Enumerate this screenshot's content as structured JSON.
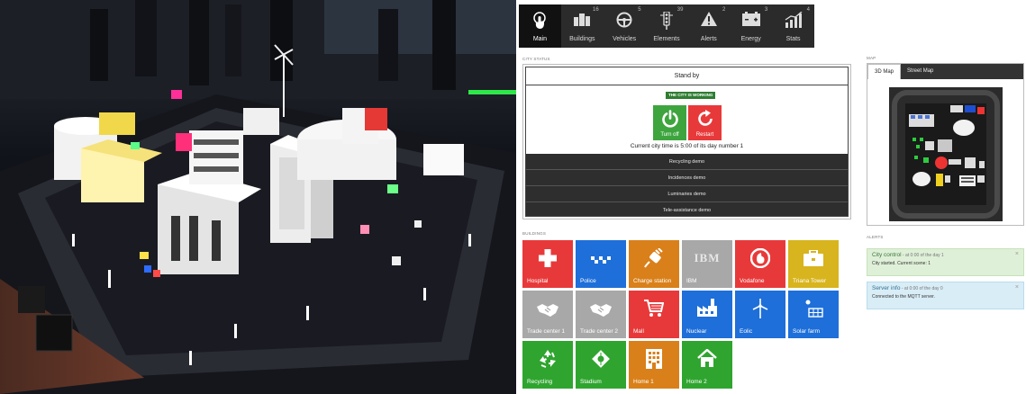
{
  "nav": {
    "items": [
      {
        "label": "Main",
        "count": "",
        "icon": "touch-icon",
        "active": true
      },
      {
        "label": "Buildings",
        "count": "16",
        "icon": "buildings-icon"
      },
      {
        "label": "Vehicles",
        "count": "5",
        "icon": "steering-wheel-icon"
      },
      {
        "label": "Elements",
        "count": "39",
        "icon": "traffic-light-icon"
      },
      {
        "label": "Alerts",
        "count": "2",
        "icon": "warning-icon"
      },
      {
        "label": "Energy",
        "count": "3",
        "icon": "battery-icon"
      },
      {
        "label": "Stats",
        "count": "4",
        "icon": "chart-icon"
      }
    ]
  },
  "city_status": {
    "section_label": "CITY STATUS",
    "state": "Stand by",
    "badge": "THE CITY IS WORKING",
    "turn_off_label": "Turn off",
    "restart_label": "Restart",
    "time_text": "Current city time is 5:00 of its day number 1",
    "demos": [
      "Recycling demo",
      "Incidences demo",
      "Luminaries demo",
      "Tele-assistance demo"
    ]
  },
  "map": {
    "section_label": "MAP",
    "tabs": [
      "3D Map",
      "Street Map"
    ]
  },
  "buildings": {
    "section_label": "BUILDINGS",
    "tiles": [
      {
        "label": "Hospital",
        "color": "#e8393a",
        "icon": "cross-icon"
      },
      {
        "label": "Police",
        "color": "#1e6fd9",
        "icon": "police-icon"
      },
      {
        "label": "Charge station",
        "color": "#d9801a",
        "icon": "plug-icon"
      },
      {
        "label": "IBM",
        "color": "#a8a8a8",
        "icon": "ibm-logo-icon",
        "icon_text": "IBM"
      },
      {
        "label": "Vodafone",
        "color": "#e8393a",
        "icon": "vodafone-icon"
      },
      {
        "label": "Triana Tower",
        "color": "#d8b41e",
        "icon": "briefcase-icon"
      },
      {
        "label": "Trade center 1",
        "color": "#a8a8a8",
        "icon": "handshake-icon"
      },
      {
        "label": "Trade center 2",
        "color": "#a8a8a8",
        "icon": "handshake-icon"
      },
      {
        "label": "Mall",
        "color": "#e8393a",
        "icon": "cart-icon"
      },
      {
        "label": "Nuclear",
        "color": "#1e6fd9",
        "icon": "factory-icon"
      },
      {
        "label": "Eolic",
        "color": "#1e6fd9",
        "icon": "wind-turbine-icon"
      },
      {
        "label": "Solar farm",
        "color": "#1e6fd9",
        "icon": "solar-panel-icon"
      },
      {
        "label": "Recycling",
        "color": "#2fa52f",
        "icon": "recycle-icon"
      },
      {
        "label": "Stadium",
        "color": "#2fa52f",
        "icon": "stadium-icon"
      },
      {
        "label": "Home 1",
        "color": "#d9801a",
        "icon": "apartment-icon"
      },
      {
        "label": "Home 2",
        "color": "#2fa52f",
        "icon": "house-icon"
      }
    ]
  },
  "alerts": {
    "section_label": "ALERTS",
    "items": [
      {
        "title": "City control",
        "time": " - at 0:00 of the day 1",
        "message": "City started. Current scene: 1",
        "close": "×"
      },
      {
        "title": "Server info",
        "time": " - at 0:00 of the day 0",
        "message": "Connected to the MQTT server.",
        "close": "×"
      }
    ]
  }
}
